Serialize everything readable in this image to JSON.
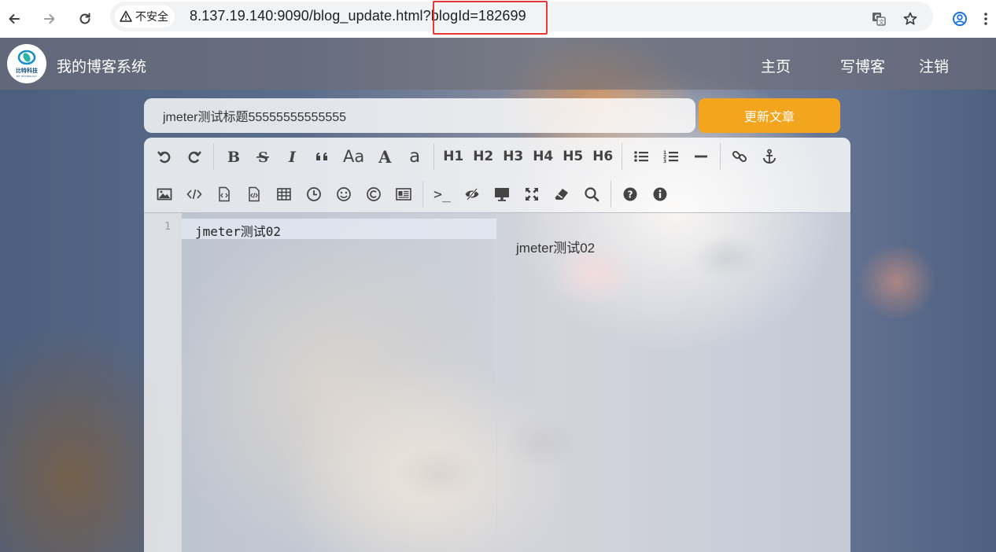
{
  "browser": {
    "security_label": "不安全",
    "url": "8.137.19.140:9090/blog_update.html?blogId=182699",
    "icons": {
      "back": "arrow-left-icon",
      "forward": "arrow-right-icon",
      "reload": "reload-icon",
      "warning": "warning-triangle-icon",
      "translate": "translate-icon",
      "bookmark": "star-icon",
      "profile": "profile-icon",
      "menu": "more-vertical-icon"
    },
    "highlight_color": "#e53935"
  },
  "site": {
    "logo_text": "比特科技",
    "logo_sub": "BIT TECHNOLOGY",
    "title": "我的博客系统",
    "nav": {
      "home": "主页",
      "write": "写博客",
      "logout": "注销"
    }
  },
  "editor": {
    "title_value": "jmeter测试标题55555555555555",
    "update_button_label": "更新文章",
    "accent_color": "#f2a51d",
    "toolbar": {
      "row1": [
        "undo-icon",
        "redo-icon",
        "bold-icon",
        "strikethrough-icon",
        "italic-icon",
        "quote-icon",
        "uppercase-icon",
        "ucfirst-icon",
        "lowercase-icon"
      ],
      "headings": [
        "H1",
        "H2",
        "H3",
        "H4",
        "H5",
        "H6"
      ],
      "row1_tail": [
        "unordered-list-icon",
        "ordered-list-icon",
        "horizontal-rule-icon",
        "link-icon",
        "anchor-icon"
      ],
      "case_labels": {
        "uppercase": "Aa",
        "ucfirst": "A",
        "lowercase": "a"
      },
      "row2": [
        "image-icon",
        "code-inline-icon",
        "code-block-icon",
        "preformatted-code-icon",
        "table-icon",
        "datetime-icon",
        "emoji-icon",
        "html-entities-icon",
        "pagebreak-icon",
        "terminal-icon",
        "watch-toggle-icon",
        "preview-icon",
        "fullscreen-icon",
        "clear-icon",
        "search-icon",
        "help-icon",
        "info-icon"
      ],
      "terminal_label": ">_"
    },
    "line_number": "1",
    "markdown_content": "jmeter测试02",
    "preview_content": "jmeter测试02"
  }
}
